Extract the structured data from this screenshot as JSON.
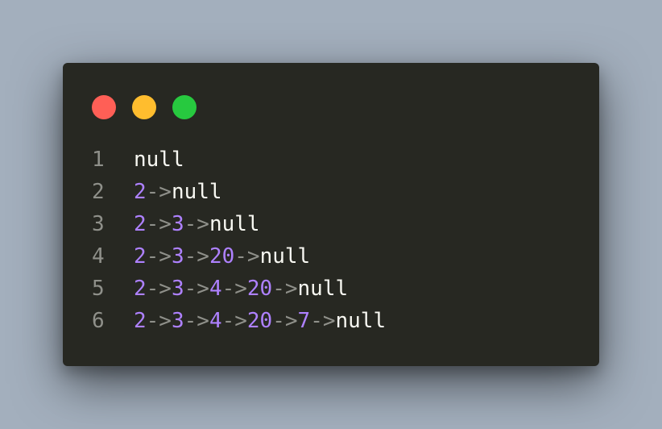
{
  "window": {
    "controls": [
      {
        "name": "close",
        "color": "#ff5f56"
      },
      {
        "name": "minimize",
        "color": "#ffbd2e"
      },
      {
        "name": "maximize",
        "color": "#27c93f"
      }
    ]
  },
  "editor": {
    "lines": [
      {
        "number": "1",
        "tokens": [
          {
            "t": "kw",
            "v": "null"
          }
        ]
      },
      {
        "number": "2",
        "tokens": [
          {
            "t": "num",
            "v": "2"
          },
          {
            "t": "arrow",
            "v": "->"
          },
          {
            "t": "kw",
            "v": "null"
          }
        ]
      },
      {
        "number": "3",
        "tokens": [
          {
            "t": "num",
            "v": "2"
          },
          {
            "t": "arrow",
            "v": "->"
          },
          {
            "t": "num",
            "v": "3"
          },
          {
            "t": "arrow",
            "v": "->"
          },
          {
            "t": "kw",
            "v": "null"
          }
        ]
      },
      {
        "number": "4",
        "tokens": [
          {
            "t": "num",
            "v": "2"
          },
          {
            "t": "arrow",
            "v": "->"
          },
          {
            "t": "num",
            "v": "3"
          },
          {
            "t": "arrow",
            "v": "->"
          },
          {
            "t": "num",
            "v": "20"
          },
          {
            "t": "arrow",
            "v": "->"
          },
          {
            "t": "kw",
            "v": "null"
          }
        ]
      },
      {
        "number": "5",
        "tokens": [
          {
            "t": "num",
            "v": "2"
          },
          {
            "t": "arrow",
            "v": "->"
          },
          {
            "t": "num",
            "v": "3"
          },
          {
            "t": "arrow",
            "v": "->"
          },
          {
            "t": "num",
            "v": "4"
          },
          {
            "t": "arrow",
            "v": "->"
          },
          {
            "t": "num",
            "v": "20"
          },
          {
            "t": "arrow",
            "v": "->"
          },
          {
            "t": "kw",
            "v": "null"
          }
        ]
      },
      {
        "number": "6",
        "tokens": [
          {
            "t": "num",
            "v": "2"
          },
          {
            "t": "arrow",
            "v": "->"
          },
          {
            "t": "num",
            "v": "3"
          },
          {
            "t": "arrow",
            "v": "->"
          },
          {
            "t": "num",
            "v": "4"
          },
          {
            "t": "arrow",
            "v": "->"
          },
          {
            "t": "num",
            "v": "20"
          },
          {
            "t": "arrow",
            "v": "->"
          },
          {
            "t": "num",
            "v": "7"
          },
          {
            "t": "arrow",
            "v": "->"
          },
          {
            "t": "kw",
            "v": "null"
          }
        ]
      }
    ]
  }
}
